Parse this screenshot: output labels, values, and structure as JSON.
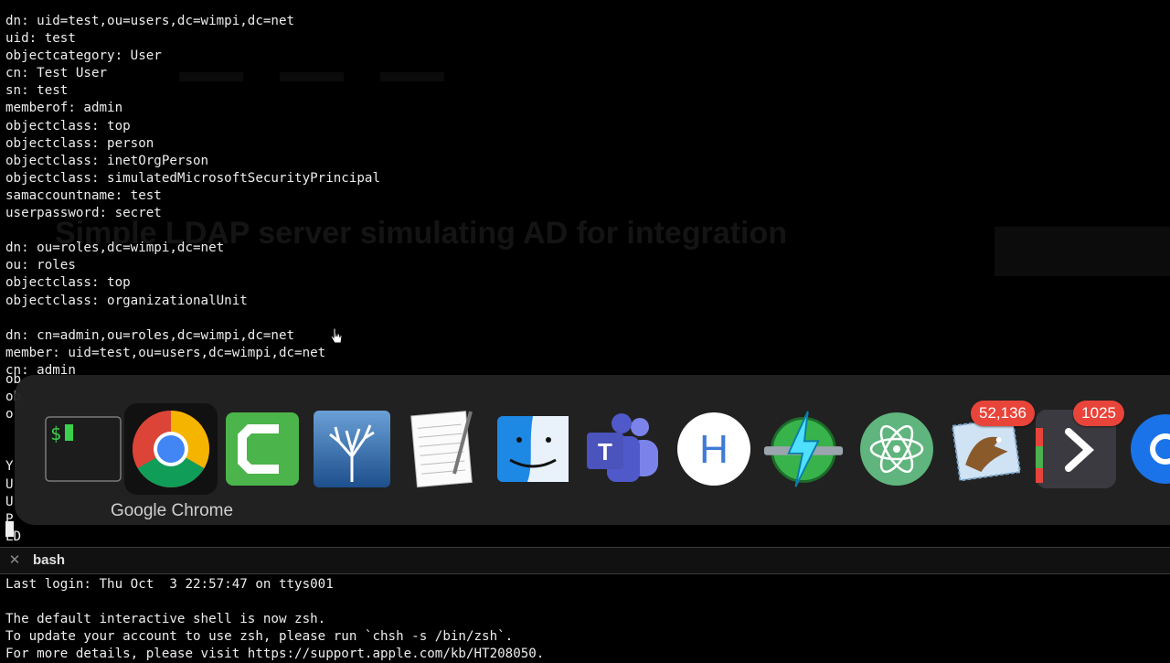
{
  "terminal_top": {
    "lines": [
      "dn: uid=test,ou=users,dc=wimpi,dc=net",
      "uid: test",
      "objectcategory: User",
      "cn: Test User",
      "sn: test",
      "memberof: admin",
      "objectclass: top",
      "objectclass: person",
      "objectclass: inetOrgPerson",
      "objectclass: simulatedMicrosoftSecurityPrincipal",
      "samaccountname: test",
      "userpassword: secret",
      "",
      "dn: ou=roles,dc=wimpi,dc=net",
      "ou: roles",
      "objectclass: top",
      "objectclass: organizationalUnit",
      "",
      "dn: cn=admin,ou=roles,dc=wimpi,dc=net",
      "member: uid=test,ou=users,dc=wimpi,dc=net",
      "cn: admin"
    ]
  },
  "background_page": {
    "title_fragment": "Simple LDAP server simulating AD for integration"
  },
  "app_switcher": {
    "selected_label": "Google Chrome",
    "apps": [
      {
        "name": "terminal-app-icon"
      },
      {
        "name": "google-chrome-icon"
      },
      {
        "name": "camtasia-icon"
      },
      {
        "name": "macfamilytree-icon"
      },
      {
        "name": "textedit-icon"
      },
      {
        "name": "finder-icon"
      },
      {
        "name": "microsoft-teams-icon"
      },
      {
        "name": "h-app-icon"
      },
      {
        "name": "lightning-network-icon"
      },
      {
        "name": "atom-editor-icon"
      },
      {
        "name": "mail-app-icon",
        "badge": "52,136"
      },
      {
        "name": "prompt-app-icon",
        "badge": "1025"
      },
      {
        "name": "partial-blue-app-icon"
      }
    ]
  },
  "bash_pane": {
    "tab_title": "bash",
    "lines": [
      "Last login: Thu Oct  3 22:57:47 on ttys001",
      "",
      "The default interactive shell is now zsh.",
      "To update your account to use zsh, please run `chsh -s /bin/zsh`.",
      "For more details, please visit https://support.apple.com/kb/HT208050."
    ]
  }
}
